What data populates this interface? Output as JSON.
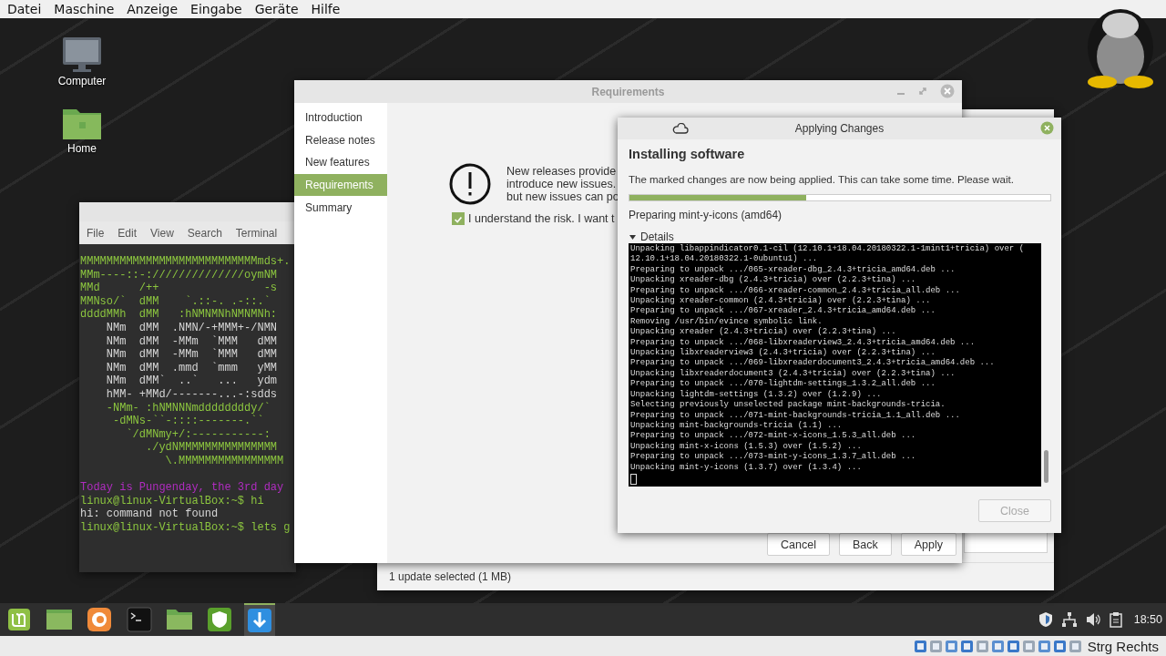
{
  "vm_menu": [
    "Datei",
    "Maschine",
    "Anzeige",
    "Eingabe",
    "Geräte",
    "Hilfe"
  ],
  "desktop_icons": [
    {
      "label": "Computer",
      "kind": "computer"
    },
    {
      "label": "Home",
      "kind": "folder"
    }
  ],
  "terminal": {
    "menu": [
      "File",
      "Edit",
      "View",
      "Search",
      "Terminal"
    ],
    "art": [
      {
        "text": "MMMMMMMMMMMMMMMMMMMMMMMMMMMmds+.",
        "color": "#8cc63f"
      },
      {
        "text": "MMm----::-://////////////oymNM",
        "color": "#8cc63f"
      },
      {
        "text": "MMd      /++                -s",
        "color": "#8cc63f"
      },
      {
        "text": "MMNso/`  dMM    `.::-. .-::.`",
        "color": "#8cc63f"
      },
      {
        "text": "ddddMMh  dMM   :hNMNMNhNMNMNh:",
        "color": "#8cc63f"
      },
      {
        "text": "    NMm  dMM  .NMN/-+MMM+-/NMN",
        "color": "#d6d6d6"
      },
      {
        "text": "    NMm  dMM  -MMm  `MMM   dMM",
        "color": "#d6d6d6"
      },
      {
        "text": "    NMm  dMM  -MMm  `MMM   dMM",
        "color": "#d6d6d6"
      },
      {
        "text": "    NMm  dMM  .mmd  `mmm   yMM",
        "color": "#d6d6d6"
      },
      {
        "text": "    NMm  dMM`  ..`   ...   ydm",
        "color": "#d6d6d6"
      },
      {
        "text": "    hMM- +MMd/-------...-:sdds",
        "color": "#d6d6d6"
      },
      {
        "text": "    -NMm- :hNMNNNmddddddddy/`",
        "color": "#8cc63f"
      },
      {
        "text": "     -dMNs-``-::::-------.``",
        "color": "#8cc63f"
      },
      {
        "text": "       `/dMNmy+/:-----------:",
        "color": "#8cc63f"
      },
      {
        "text": "          ./ydNMMMMMMMMMMMMMMM",
        "color": "#8cc63f"
      },
      {
        "text": "             \\.MMMMMMMMMMMMMMMM",
        "color": "#8cc63f"
      }
    ],
    "session": [
      {
        "text": "Today is Pungenday, the 3rd day",
        "color": "#b02cc0"
      },
      {
        "text": "linux@linux-VirtualBox:~$ hi",
        "color": "#8cc63f"
      },
      {
        "text": "hi: command not found",
        "color": "#d6d6d6"
      },
      {
        "text": "linux@linux-VirtualBox:~$ lets g",
        "color": "#8cc63f"
      }
    ]
  },
  "update_manager": {
    "status": "1 update selected (1 MB)"
  },
  "requirements": {
    "title": "Requirements",
    "steps": [
      {
        "label": "Introduction",
        "selected": false
      },
      {
        "label": "Release notes",
        "selected": false
      },
      {
        "label": "New features",
        "selected": false
      },
      {
        "label": "Requirements",
        "selected": true
      },
      {
        "label": "Summary",
        "selected": false
      }
    ],
    "message_lines": [
      "New releases provide",
      "introduce new issues.",
      "but new issues can po"
    ],
    "risk_checkbox": {
      "label": "I understand the risk. I want t",
      "checked": true
    },
    "buttons": [
      "Cancel",
      "Back",
      "Apply"
    ]
  },
  "applying": {
    "title": "Applying Changes",
    "heading": "Installing software",
    "description": "The marked changes are now being applied. This can take some time. Please wait.",
    "progress": {
      "level": 0.42
    },
    "current": "Preparing mint-y-icons (amd64)",
    "details": {
      "label": "Details",
      "expanded": true
    },
    "log": [
      "Unpacking libappindicator0.1-cil (12.10.1+18.04.20180322.1-1mint1+tricia) over (",
      "12.10.1+18.04.20180322.1-0ubuntu1) ...",
      "Preparing to unpack .../065-xreader-dbg_2.4.3+tricia_amd64.deb ...",
      "Unpacking xreader-dbg (2.4.3+tricia) over (2.2.3+tina) ...",
      "Preparing to unpack .../066-xreader-common_2.4.3+tricia_all.deb ...",
      "Unpacking xreader-common (2.4.3+tricia) over (2.2.3+tina) ...",
      "Preparing to unpack .../067-xreader_2.4.3+tricia_amd64.deb ...",
      "Removing /usr/bin/evince symbolic link.",
      "Unpacking xreader (2.4.3+tricia) over (2.2.3+tina) ...",
      "Preparing to unpack .../068-libxreaderview3_2.4.3+tricia_amd64.deb ...",
      "Unpacking libxreaderview3 (2.4.3+tricia) over (2.2.3+tina) ...",
      "Preparing to unpack .../069-libxreaderdocument3_2.4.3+tricia_amd64.deb ...",
      "Unpacking libxreaderdocument3 (2.4.3+tricia) over (2.2.3+tina) ...",
      "Preparing to unpack .../070-lightdm-settings_1.3.2_all.deb ...",
      "Unpacking lightdm-settings (1.3.2) over (1.2.9) ...",
      "Selecting previously unselected package mint-backgrounds-tricia.",
      "Preparing to unpack .../071-mint-backgrounds-tricia_1.1_all.deb ...",
      "Unpacking mint-backgrounds-tricia (1.1) ...",
      "Preparing to unpack .../072-mint-x-icons_1.5.3_all.deb ...",
      "Unpacking mint-x-icons (1.5.3) over (1.5.2) ...",
      "Preparing to unpack .../073-mint-y-icons_1.3.7_all.deb ...",
      "Unpacking mint-y-icons (1.3.7) over (1.3.4) ..."
    ],
    "close_button": {
      "label": "Close",
      "disabled": true
    }
  },
  "taskbar": {
    "apps": [
      {
        "kind": "mint",
        "active": false
      },
      {
        "kind": "files",
        "active": false
      },
      {
        "kind": "browser",
        "active": false
      },
      {
        "kind": "terminal",
        "active": false
      },
      {
        "kind": "folder",
        "active": false
      },
      {
        "kind": "shield",
        "active": false
      },
      {
        "kind": "update",
        "active": true
      }
    ],
    "tray": [
      {
        "kind": "shield"
      },
      {
        "kind": "network"
      },
      {
        "kind": "volume"
      },
      {
        "kind": "clipboard"
      }
    ],
    "clock": "18:50"
  },
  "vbox_status": {
    "host_key": "Strg Rechts"
  }
}
